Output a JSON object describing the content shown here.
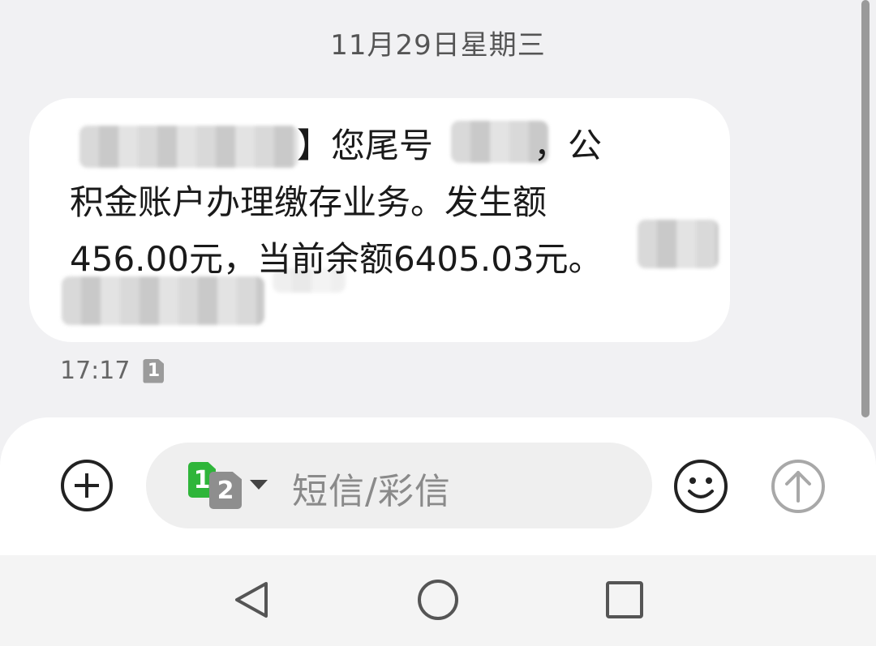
{
  "date_header": "11月29日星期三",
  "message": {
    "line1_suffix": "】您尾号",
    "line1_end": "，公",
    "line2": "积金账户办理缴存业务。发生额",
    "line3": "456.00元，当前余额6405.03元。",
    "time": "17:17",
    "sim_badge": "1"
  },
  "composer": {
    "placeholder": "短信/彩信",
    "sim1": "1",
    "sim2": "2"
  },
  "icons": {
    "add": "plus-circle-icon",
    "emoji": "smiley-icon",
    "send": "arrow-up-circle-icon",
    "back": "triangle-back-icon",
    "home": "circle-home-icon",
    "recents": "square-recents-icon"
  },
  "colors": {
    "sim1": "#2fb53a",
    "sim2": "#8e8e8e",
    "send_disabled": "#a8a8a8"
  }
}
